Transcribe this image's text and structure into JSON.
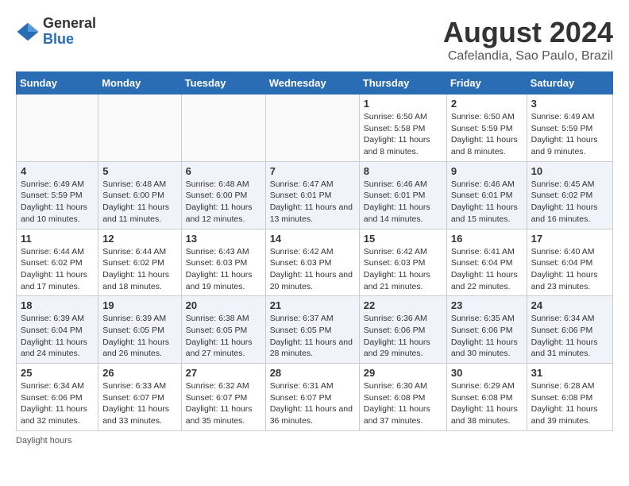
{
  "header": {
    "logo_general": "General",
    "logo_blue": "Blue",
    "month_title": "August 2024",
    "location": "Cafelandia, Sao Paulo, Brazil"
  },
  "days_of_week": [
    "Sunday",
    "Monday",
    "Tuesday",
    "Wednesday",
    "Thursday",
    "Friday",
    "Saturday"
  ],
  "weeks": [
    [
      {
        "day": "",
        "info": ""
      },
      {
        "day": "",
        "info": ""
      },
      {
        "day": "",
        "info": ""
      },
      {
        "day": "",
        "info": ""
      },
      {
        "day": "1",
        "info": "Sunrise: 6:50 AM\nSunset: 5:58 PM\nDaylight: 11 hours and 8 minutes."
      },
      {
        "day": "2",
        "info": "Sunrise: 6:50 AM\nSunset: 5:59 PM\nDaylight: 11 hours and 8 minutes."
      },
      {
        "day": "3",
        "info": "Sunrise: 6:49 AM\nSunset: 5:59 PM\nDaylight: 11 hours and 9 minutes."
      }
    ],
    [
      {
        "day": "4",
        "info": "Sunrise: 6:49 AM\nSunset: 5:59 PM\nDaylight: 11 hours and 10 minutes."
      },
      {
        "day": "5",
        "info": "Sunrise: 6:48 AM\nSunset: 6:00 PM\nDaylight: 11 hours and 11 minutes."
      },
      {
        "day": "6",
        "info": "Sunrise: 6:48 AM\nSunset: 6:00 PM\nDaylight: 11 hours and 12 minutes."
      },
      {
        "day": "7",
        "info": "Sunrise: 6:47 AM\nSunset: 6:01 PM\nDaylight: 11 hours and 13 minutes."
      },
      {
        "day": "8",
        "info": "Sunrise: 6:46 AM\nSunset: 6:01 PM\nDaylight: 11 hours and 14 minutes."
      },
      {
        "day": "9",
        "info": "Sunrise: 6:46 AM\nSunset: 6:01 PM\nDaylight: 11 hours and 15 minutes."
      },
      {
        "day": "10",
        "info": "Sunrise: 6:45 AM\nSunset: 6:02 PM\nDaylight: 11 hours and 16 minutes."
      }
    ],
    [
      {
        "day": "11",
        "info": "Sunrise: 6:44 AM\nSunset: 6:02 PM\nDaylight: 11 hours and 17 minutes."
      },
      {
        "day": "12",
        "info": "Sunrise: 6:44 AM\nSunset: 6:02 PM\nDaylight: 11 hours and 18 minutes."
      },
      {
        "day": "13",
        "info": "Sunrise: 6:43 AM\nSunset: 6:03 PM\nDaylight: 11 hours and 19 minutes."
      },
      {
        "day": "14",
        "info": "Sunrise: 6:42 AM\nSunset: 6:03 PM\nDaylight: 11 hours and 20 minutes."
      },
      {
        "day": "15",
        "info": "Sunrise: 6:42 AM\nSunset: 6:03 PM\nDaylight: 11 hours and 21 minutes."
      },
      {
        "day": "16",
        "info": "Sunrise: 6:41 AM\nSunset: 6:04 PM\nDaylight: 11 hours and 22 minutes."
      },
      {
        "day": "17",
        "info": "Sunrise: 6:40 AM\nSunset: 6:04 PM\nDaylight: 11 hours and 23 minutes."
      }
    ],
    [
      {
        "day": "18",
        "info": "Sunrise: 6:39 AM\nSunset: 6:04 PM\nDaylight: 11 hours and 24 minutes."
      },
      {
        "day": "19",
        "info": "Sunrise: 6:39 AM\nSunset: 6:05 PM\nDaylight: 11 hours and 26 minutes."
      },
      {
        "day": "20",
        "info": "Sunrise: 6:38 AM\nSunset: 6:05 PM\nDaylight: 11 hours and 27 minutes."
      },
      {
        "day": "21",
        "info": "Sunrise: 6:37 AM\nSunset: 6:05 PM\nDaylight: 11 hours and 28 minutes."
      },
      {
        "day": "22",
        "info": "Sunrise: 6:36 AM\nSunset: 6:06 PM\nDaylight: 11 hours and 29 minutes."
      },
      {
        "day": "23",
        "info": "Sunrise: 6:35 AM\nSunset: 6:06 PM\nDaylight: 11 hours and 30 minutes."
      },
      {
        "day": "24",
        "info": "Sunrise: 6:34 AM\nSunset: 6:06 PM\nDaylight: 11 hours and 31 minutes."
      }
    ],
    [
      {
        "day": "25",
        "info": "Sunrise: 6:34 AM\nSunset: 6:06 PM\nDaylight: 11 hours and 32 minutes."
      },
      {
        "day": "26",
        "info": "Sunrise: 6:33 AM\nSunset: 6:07 PM\nDaylight: 11 hours and 33 minutes."
      },
      {
        "day": "27",
        "info": "Sunrise: 6:32 AM\nSunset: 6:07 PM\nDaylight: 11 hours and 35 minutes."
      },
      {
        "day": "28",
        "info": "Sunrise: 6:31 AM\nSunset: 6:07 PM\nDaylight: 11 hours and 36 minutes."
      },
      {
        "day": "29",
        "info": "Sunrise: 6:30 AM\nSunset: 6:08 PM\nDaylight: 11 hours and 37 minutes."
      },
      {
        "day": "30",
        "info": "Sunrise: 6:29 AM\nSunset: 6:08 PM\nDaylight: 11 hours and 38 minutes."
      },
      {
        "day": "31",
        "info": "Sunrise: 6:28 AM\nSunset: 6:08 PM\nDaylight: 11 hours and 39 minutes."
      }
    ]
  ],
  "footer_note": "Daylight hours"
}
